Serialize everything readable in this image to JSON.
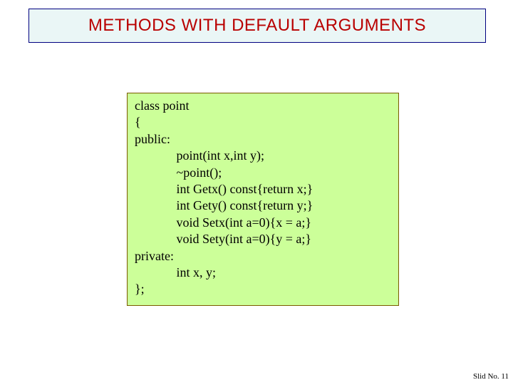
{
  "title": "METHODS WITH DEFAULT ARGUMENTS",
  "code": {
    "l1": "class point",
    "l2": "{",
    "l3": "public:",
    "l4": "             point(int x,int y);",
    "l5": "             ~point();",
    "l6": "             int Getx() const{return x;}",
    "l7": "             int Gety() const{return y;}",
    "l8": "             void Setx(int a=0){x = a;}",
    "l9": "             void Sety(int a=0){y = a;}",
    "l10": "",
    "l11": "private:",
    "l12": "             int x, y;",
    "l13": "};"
  },
  "footer": "Slid No. 11"
}
